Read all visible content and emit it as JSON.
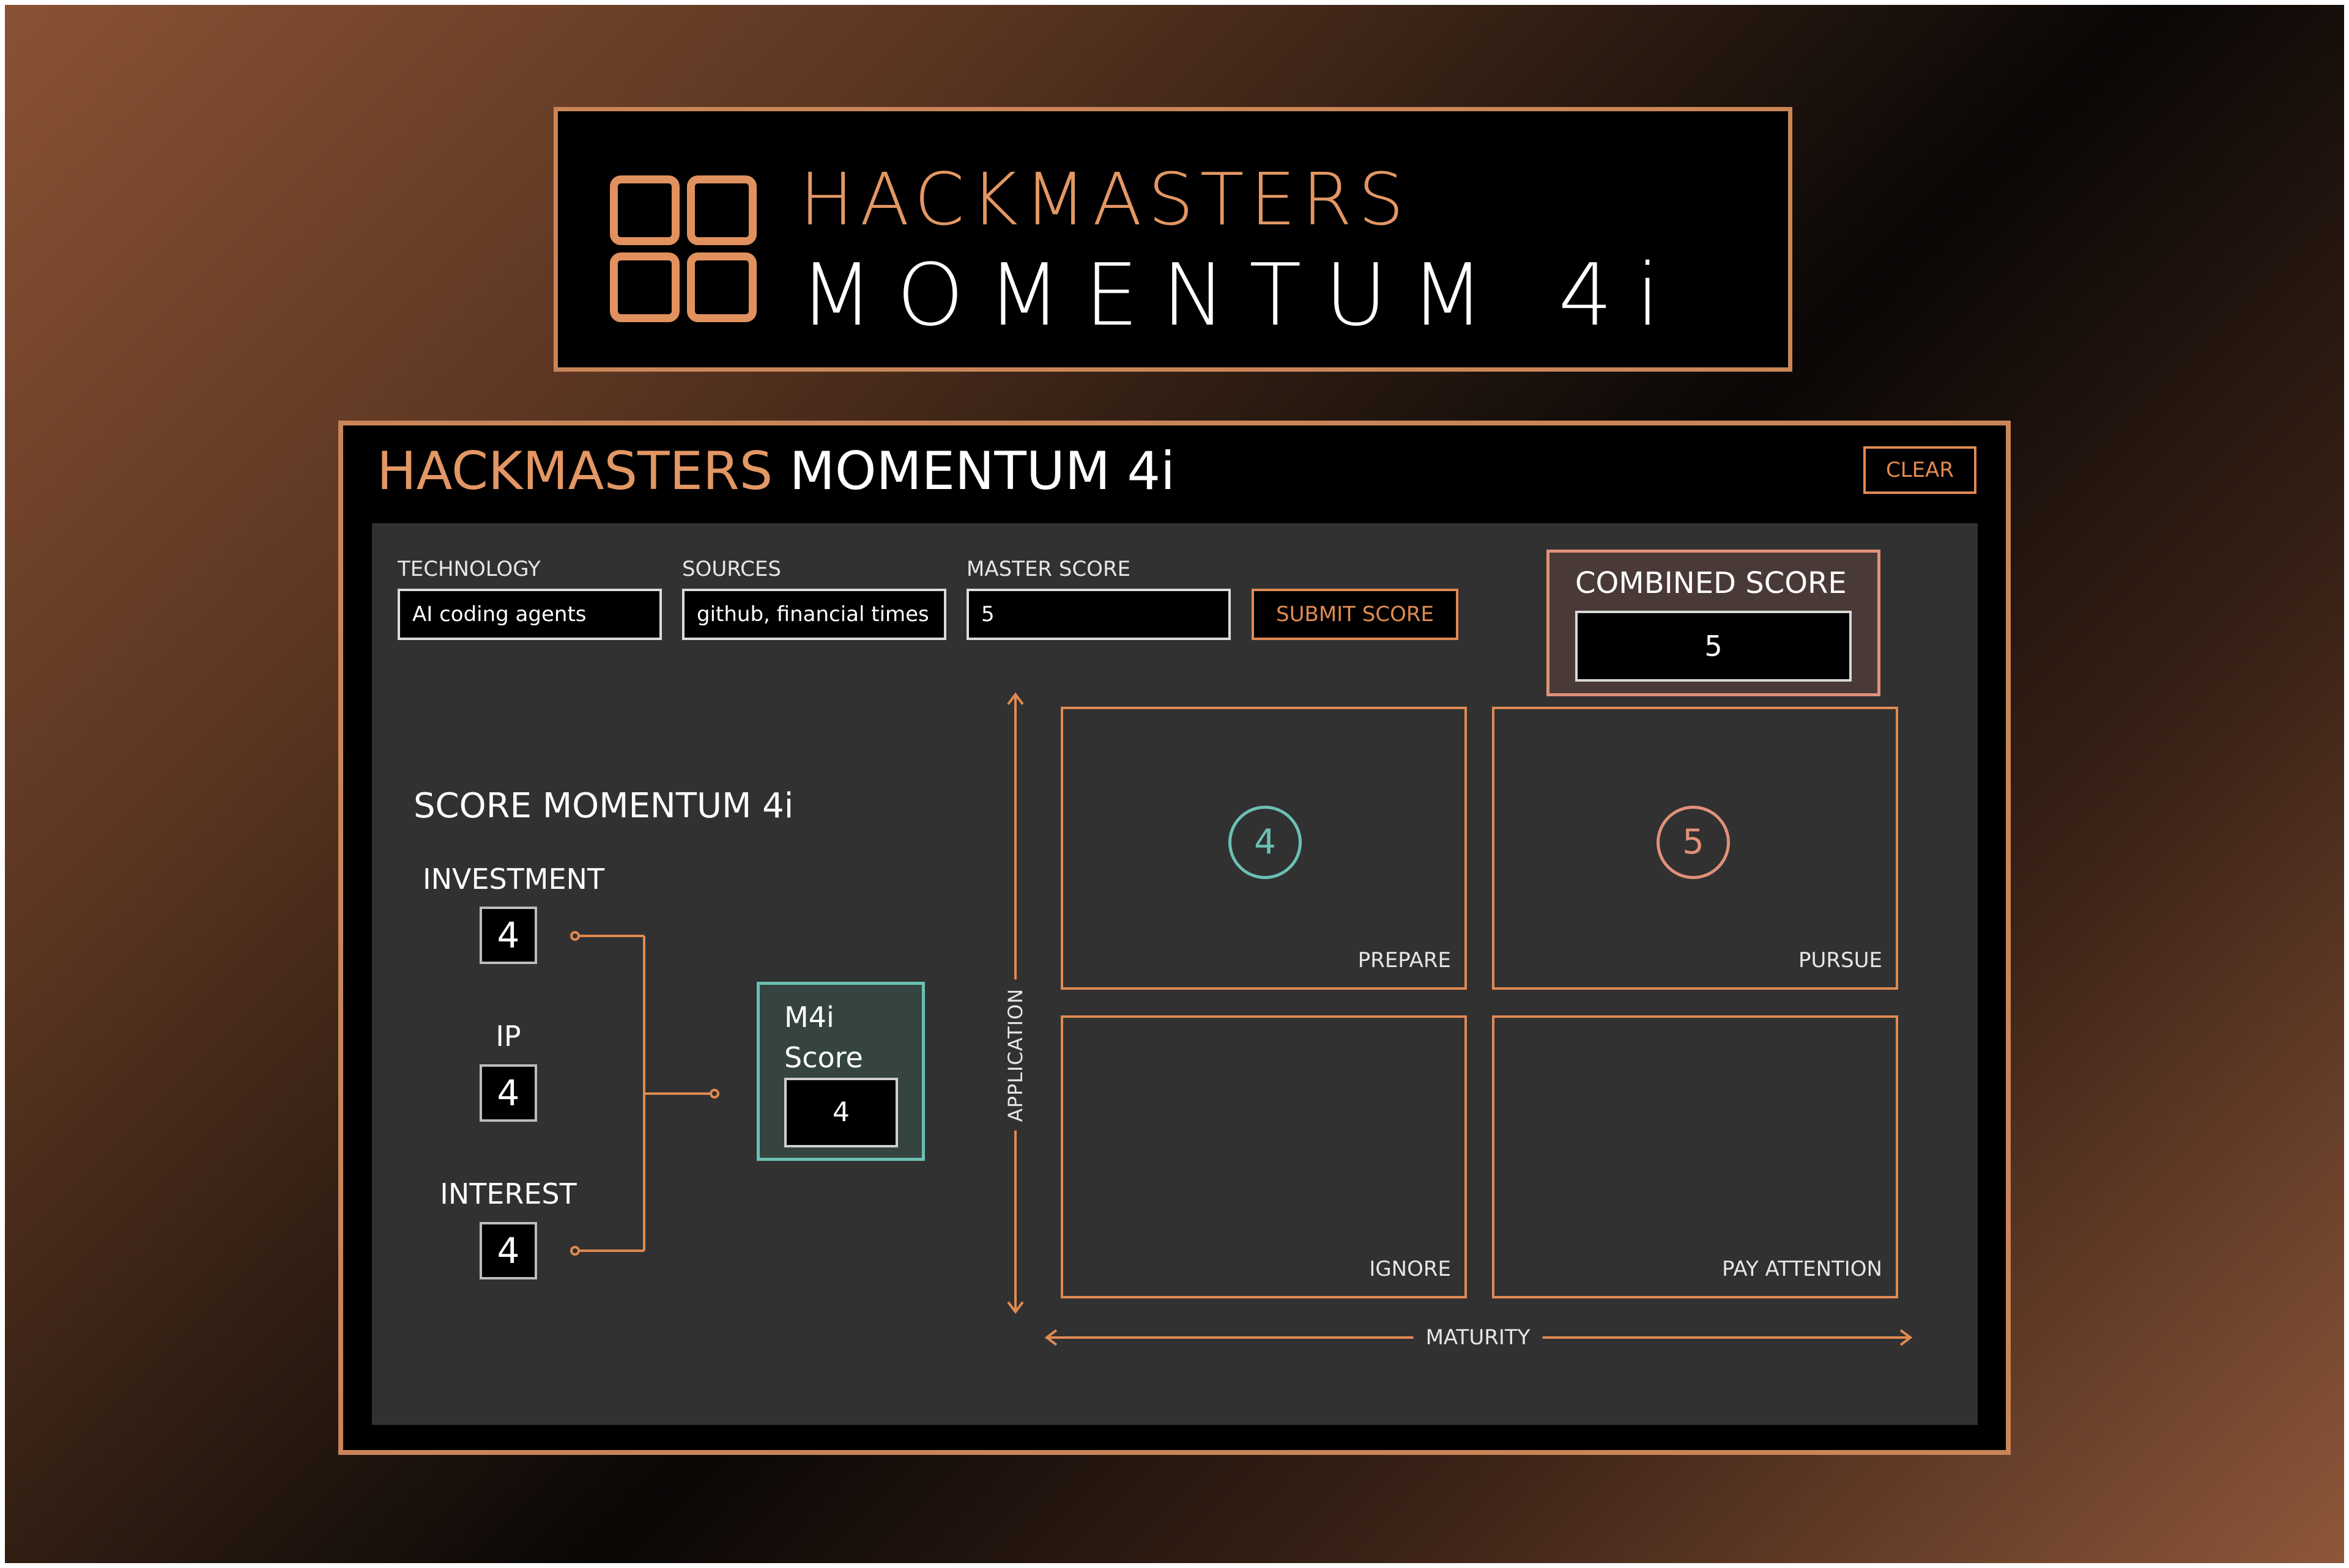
{
  "banner": {
    "line1": "HACKMASTERS",
    "line2": "MOMENTUM 4i"
  },
  "app": {
    "title_part1": "HACKMASTERS",
    "title_part2": "MOMENTUM 4i",
    "clear_label": "CLEAR"
  },
  "form": {
    "technology_label": "TECHNOLOGY",
    "technology_value": "AI coding agents",
    "sources_label": "SOURCES",
    "sources_value": "github, financial times",
    "master_label": "MASTER SCORE",
    "master_value": "5",
    "submit_label": "SUBMIT SCORE"
  },
  "combined": {
    "label": "COMBINED SCORE",
    "value": "5"
  },
  "scoring": {
    "title": "SCORE MOMENTUM 4i",
    "categories": [
      {
        "label": "INVESTMENT",
        "value": "4"
      },
      {
        "label": "IP",
        "value": "4"
      },
      {
        "label": "INTEREST",
        "value": "4"
      }
    ],
    "m4i_label": "M4i Score",
    "m4i_value": "4"
  },
  "matrix": {
    "y_axis": "APPLICATION",
    "x_axis": "MATURITY",
    "quadrants": [
      "PREPARE",
      "PURSUE",
      "IGNORE",
      "PAY ATTENTION"
    ],
    "markers": [
      {
        "quadrant": "PREPARE",
        "value": "4",
        "color": "#6cc0b4"
      },
      {
        "quadrant": "PURSUE",
        "value": "5",
        "color": "#e0917a"
      }
    ]
  },
  "colors": {
    "accent": "#e08a52",
    "frame": "#c98558",
    "teal": "#6cc0b4",
    "salmon": "#e0917a",
    "panel": "#313131"
  }
}
